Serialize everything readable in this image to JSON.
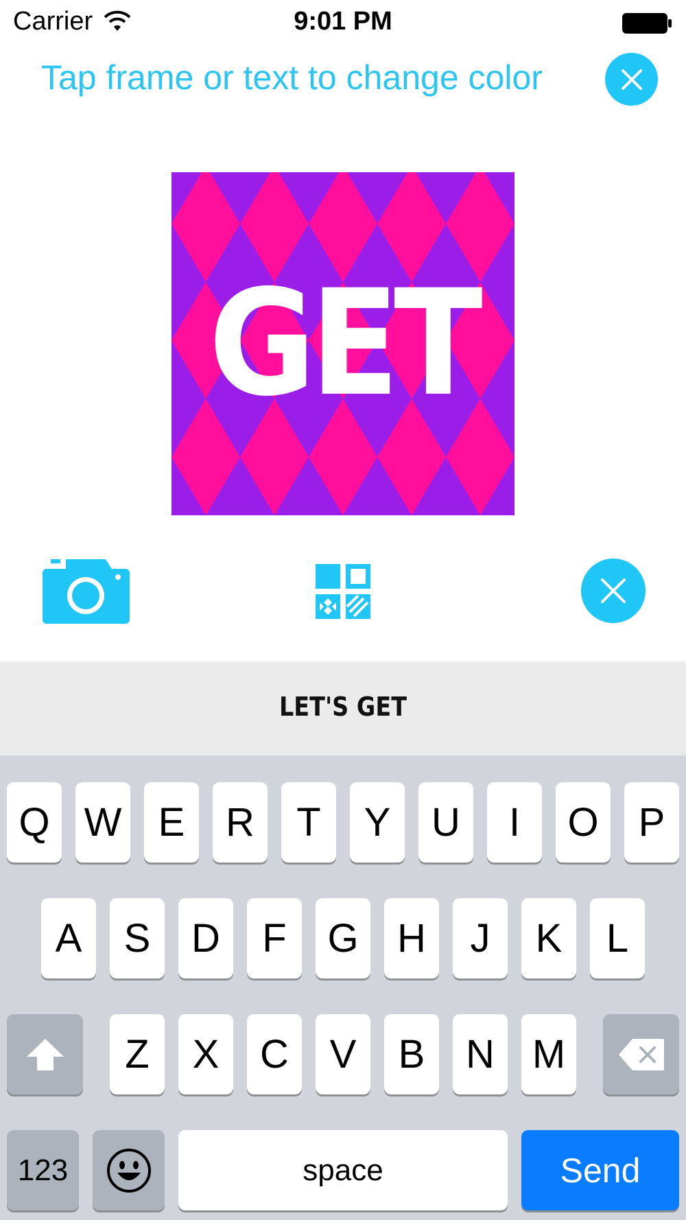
{
  "status_bar": {
    "carrier": "Carrier",
    "time": "9:01 PM",
    "wifi_icon": "wifi-icon",
    "battery_icon": "battery-icon"
  },
  "header": {
    "instruction": "Tap frame or text to change color",
    "close_icon": "close-icon"
  },
  "preview": {
    "word": "GET",
    "pattern": "argyle-diamond",
    "colors": {
      "background": "#9b1ee8",
      "diamond": "#ff0f9b",
      "text": "#ffffff"
    }
  },
  "toolbar": {
    "camera_icon": "camera-icon",
    "layout_icon": "layout-grid-icon",
    "close_icon": "close-icon"
  },
  "text_strip": {
    "label": "LET'S GET"
  },
  "keyboard": {
    "row1": [
      "Q",
      "W",
      "E",
      "R",
      "T",
      "Y",
      "U",
      "I",
      "O",
      "P"
    ],
    "row2": [
      "A",
      "S",
      "D",
      "F",
      "G",
      "H",
      "J",
      "K",
      "L"
    ],
    "row3": [
      "Z",
      "X",
      "C",
      "V",
      "B",
      "N",
      "M"
    ],
    "shift_icon": "shift-icon",
    "backspace_icon": "backspace-icon",
    "numbers_label": "123",
    "emoji_icon": "emoji-icon",
    "space_label": "space",
    "send_label": "Send"
  },
  "colors": {
    "accent": "#1fc6f6",
    "header_text": "#2cc5f1",
    "keyboard_bg": "#d1d5db",
    "send_key": "#0a7cff"
  }
}
